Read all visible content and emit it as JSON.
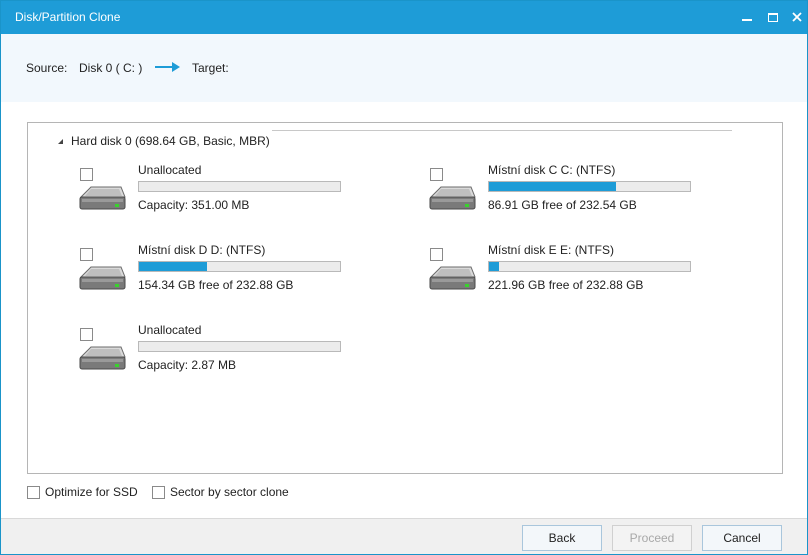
{
  "window": {
    "title": "Disk/Partition Clone"
  },
  "header": {
    "source_label": "Source:",
    "source_value": "Disk 0 ( C: )",
    "target_label": "Target:"
  },
  "disk": {
    "label": "Hard disk 0 (698.64 GB, Basic, MBR)"
  },
  "partitions": [
    {
      "name": "Unallocated",
      "detail": "Capacity: 351.00 MB",
      "used_fraction": 0
    },
    {
      "name": "Místní disk C C: (NTFS)",
      "detail": "86.91 GB free of 232.54 GB",
      "used_fraction": 0.63
    },
    {
      "name": "Místní disk D D: (NTFS)",
      "detail": "154.34 GB free of 232.88 GB",
      "used_fraction": 0.34
    },
    {
      "name": "Místní disk E E: (NTFS)",
      "detail": "221.96 GB free of 232.88 GB",
      "used_fraction": 0.05
    },
    {
      "name": "Unallocated",
      "detail": "Capacity: 2.87 MB",
      "used_fraction": 0
    }
  ],
  "options": {
    "optimize_ssd": "Optimize for SSD",
    "sector_clone": "Sector by sector clone"
  },
  "buttons": {
    "back": "Back",
    "proceed": "Proceed",
    "cancel": "Cancel"
  },
  "colors": {
    "accent": "#1e9cd7"
  }
}
